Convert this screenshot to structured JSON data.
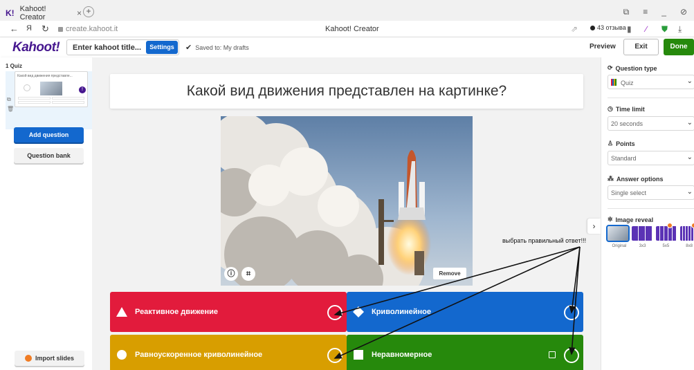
{
  "browser": {
    "tab_favicon": "K!",
    "tab_title": "Kahoot! Creator",
    "tab_close": "×",
    "new_tab": "+",
    "window_controls": [
      "⧉",
      "≡",
      "_",
      "⊘"
    ],
    "nav_back": "←",
    "nav_yandex": "Я",
    "nav_reload": "↻",
    "url": "create.kahoot.it",
    "page_title": "Kahoot! Creator",
    "reviews": "43 отзыва"
  },
  "kahoot": {
    "logo": "Kahoot!",
    "title_placeholder": "Enter kahoot title...",
    "settings": "Settings",
    "saved": "Saved to: My drafts",
    "preview": "Preview",
    "exit": "Exit",
    "done": "Done"
  },
  "sidebar": {
    "slide_label": "1  Quiz",
    "slide_text": "Какой вид движения представле...",
    "slide_warn": "!",
    "add_question": "Add question",
    "question_bank": "Question bank",
    "import_slides": "Import slides"
  },
  "editor": {
    "question": "Какой вид движения представлен на картинке?",
    "remove": "Remove",
    "answers": [
      {
        "text": "Реактивное движение",
        "color": "#e21b3c",
        "shape": "triangle"
      },
      {
        "text": "Криволинейное",
        "color": "#1368ce",
        "shape": "diamond"
      },
      {
        "text": "Равноускоренное криволинейное",
        "color": "#d89e00",
        "shape": "circle"
      },
      {
        "text": "Неравномерное",
        "color": "#26890c",
        "shape": "square"
      }
    ]
  },
  "right_panel": {
    "question_type_label": "Question type",
    "question_type_value": "Quiz",
    "time_limit_label": "Time limit",
    "time_limit_value": "20 seconds",
    "points_label": "Points",
    "points_value": "Standard",
    "answer_options_label": "Answer options",
    "answer_options_value": "Single select",
    "image_reveal_label": "Image reveal",
    "reveal_options": [
      "Original",
      "3x3",
      "5x5",
      "8x8"
    ]
  },
  "annotation": {
    "note": "выбрать правильный ответ!!!"
  }
}
